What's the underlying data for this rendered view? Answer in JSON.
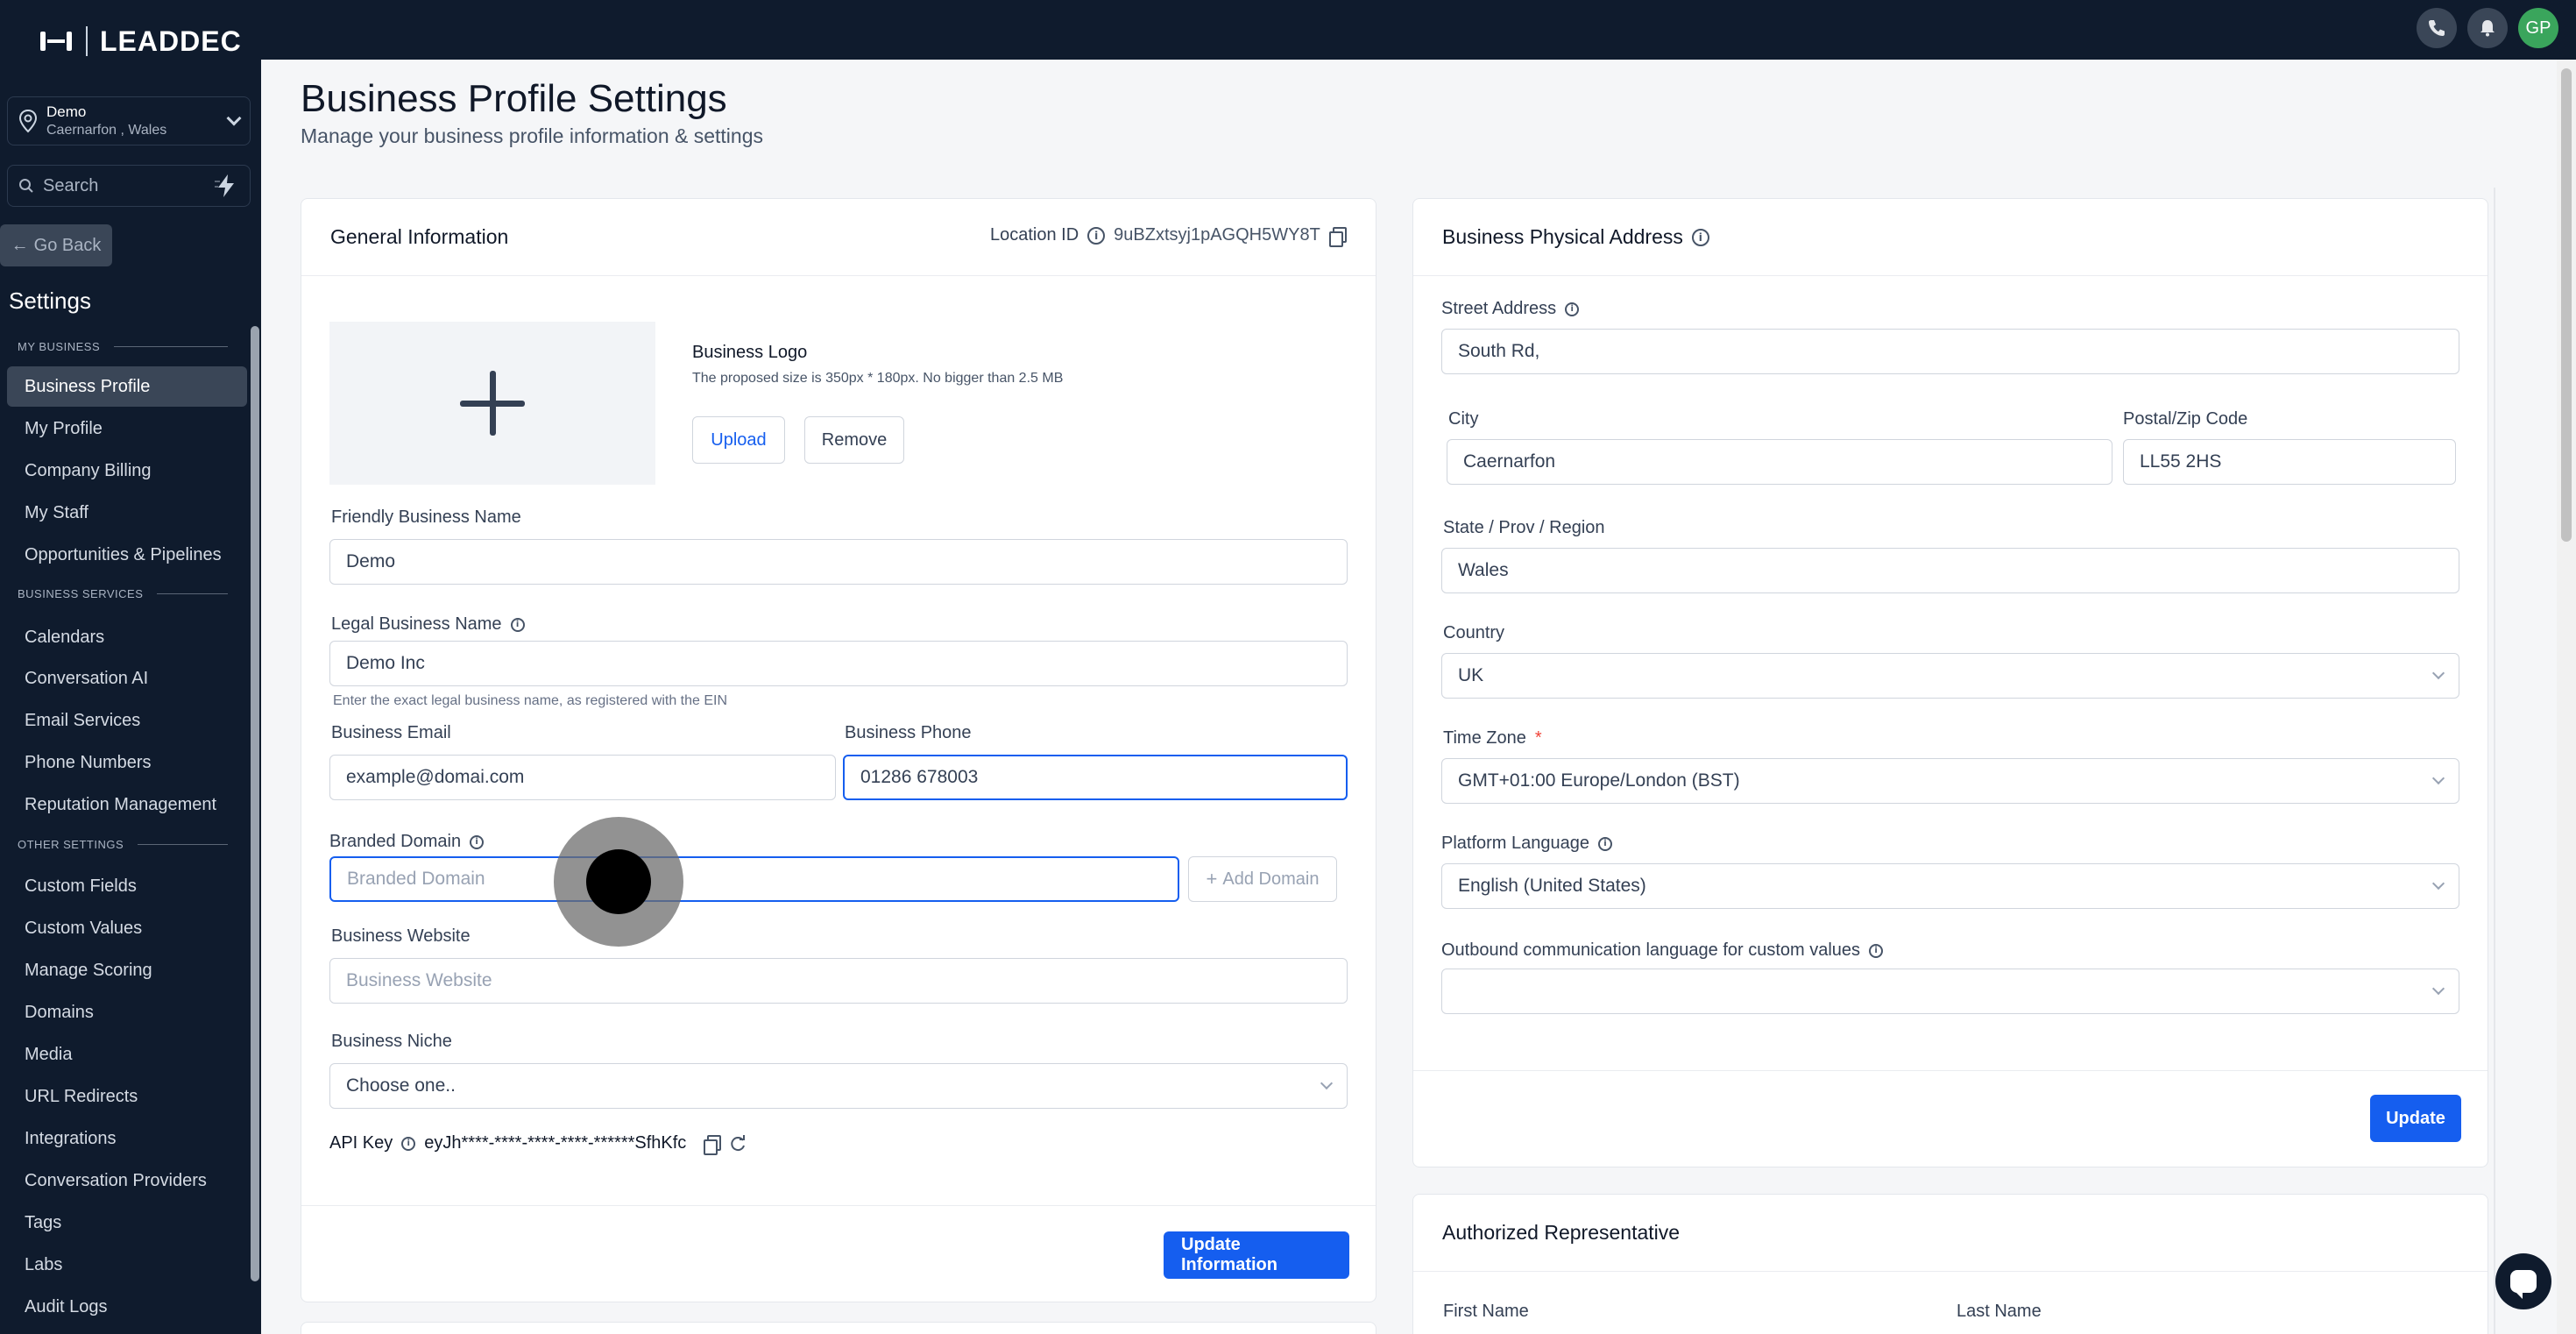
{
  "brand": {
    "name": "LEADDEC"
  },
  "location_switcher": {
    "name": "Demo",
    "region": "Caernarfon , Wales"
  },
  "search": {
    "placeholder": "Search"
  },
  "nav": {
    "go_back": "Go Back",
    "title": "Settings",
    "sections": [
      {
        "heading": "MY BUSINESS",
        "items": [
          "Business Profile",
          "My Profile",
          "Company Billing",
          "My Staff",
          "Opportunities & Pipelines"
        ]
      },
      {
        "heading": "BUSINESS SERVICES",
        "items": [
          "Calendars",
          "Conversation AI",
          "Email Services",
          "Phone Numbers",
          "Reputation Management"
        ]
      },
      {
        "heading": "OTHER SETTINGS",
        "items": [
          "Custom Fields",
          "Custom Values",
          "Manage Scoring",
          "Domains",
          "Media",
          "URL Redirects",
          "Integrations",
          "Conversation Providers",
          "Tags",
          "Labs",
          "Audit Logs"
        ]
      }
    ],
    "active": "Business Profile"
  },
  "topbar": {
    "avatar_initials": "GP",
    "icons": [
      "phone-icon",
      "bell-icon"
    ]
  },
  "page": {
    "title": "Business Profile Settings",
    "subtitle": "Manage your business profile information & settings"
  },
  "general": {
    "title": "General Information",
    "location_id_label": "Location ID",
    "location_id": "9uBZxtsyj1pAGQH5WY8T",
    "logo_title": "Business Logo",
    "logo_hint": "The proposed size is 350px * 180px. No bigger than 2.5 MB",
    "upload_label": "Upload",
    "remove_label": "Remove",
    "friendly_name_label": "Friendly Business Name",
    "friendly_name": "Demo",
    "legal_name_label": "Legal Business Name",
    "legal_name": "Demo Inc",
    "legal_hint": "Enter the exact legal business name, as registered with the EIN",
    "email_label": "Business Email",
    "email": "example@domai.com",
    "phone_label": "Business Phone",
    "phone": "01286 678003",
    "domain_label": "Branded Domain",
    "domain_placeholder": "Branded Domain",
    "add_domain_label": "Add Domain",
    "website_label": "Business Website",
    "website_placeholder": "Business Website",
    "niche_label": "Business Niche",
    "niche_value": "Choose one..",
    "api_key_label": "API Key",
    "api_key": "eyJh****-****-****-****-******SfhKfc",
    "update_label": "Update Information"
  },
  "address": {
    "title": "Business Physical Address",
    "street_label": "Street Address",
    "street": "South Rd,",
    "city_label": "City",
    "city": "Caernarfon",
    "postal_label": "Postal/Zip Code",
    "postal": "LL55 2HS",
    "state_label": "State / Prov / Region",
    "state": "Wales",
    "country_label": "Country",
    "country": "UK",
    "timezone_label": "Time Zone",
    "timezone_required": "*",
    "timezone": "GMT+01:00 Europe/London (BST)",
    "language_label": "Platform Language",
    "language": "English (United States)",
    "outbound_label": "Outbound communication language for custom values",
    "outbound": "",
    "update_label": "Update"
  },
  "representative": {
    "title": "Authorized Representative",
    "first_name_label": "First Name",
    "last_name_label": "Last Name"
  },
  "colors": {
    "primary": "#155eef",
    "sidebar": "#0f1b2d",
    "avatar": "#3aa55c"
  }
}
